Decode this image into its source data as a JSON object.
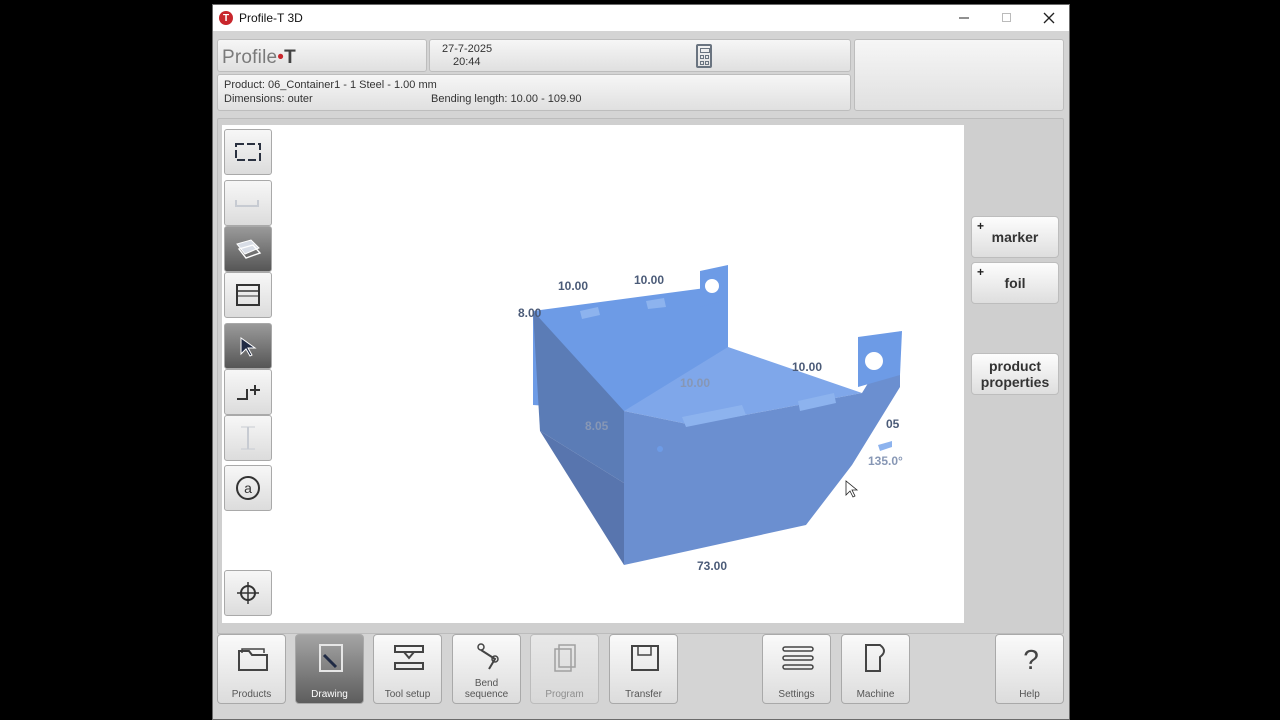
{
  "window": {
    "title": "Profile-T 3D",
    "app_icon_letter": "T"
  },
  "header": {
    "logo_part1": "Profile",
    "logo_dot": "•",
    "logo_part2": "T",
    "date": "27-7-2025",
    "time": "20:44",
    "product_line": "Product: 06_Container1 - 1 Steel - 1.00 mm",
    "dimensions": "Dimensions: outer",
    "bending_length": "Bending length: 10.00 - 109.90"
  },
  "drawing": {
    "part_color": "#5f8fdc",
    "dimensions": [
      "10.00",
      "10.00",
      "8.00",
      "10.00",
      "10.00",
      "8.05",
      "05",
      "135.0°",
      "73.00"
    ]
  },
  "side_tools": [
    {
      "icon": "fit-view-icon"
    },
    {
      "icon": "flat-profile-icon"
    },
    {
      "icon": "layers-icon"
    },
    {
      "icon": "sheet-view-icon"
    },
    {
      "icon": "select-arrow-icon"
    },
    {
      "icon": "add-flange-icon"
    },
    {
      "icon": "measure-icon"
    },
    {
      "icon": "at-sign-icon"
    },
    {
      "icon": "rotate-view-icon"
    }
  ],
  "right_buttons": {
    "marker": "marker",
    "foil": "foil",
    "product_properties_line1": "product",
    "product_properties_line2": "properties",
    "plus": "+"
  },
  "bottom_nav": {
    "products": "Products",
    "drawing": "Drawing",
    "tool_setup": "Tool setup",
    "bend_sequence_line1": "Bend",
    "bend_sequence_line2": "sequence",
    "program": "Program",
    "transfer": "Transfer",
    "settings": "Settings",
    "machine": "Machine",
    "help": "Help"
  }
}
